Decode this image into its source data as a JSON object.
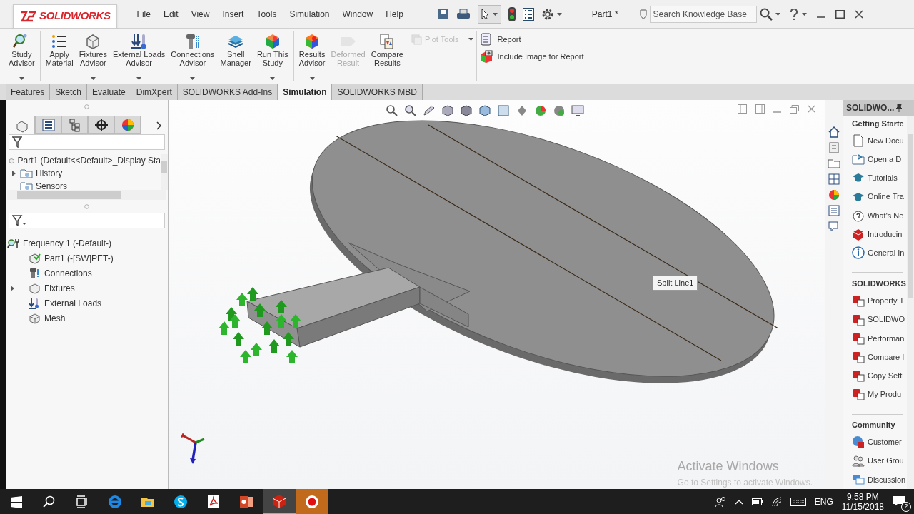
{
  "logo": {
    "brand": "SOLIDWORKS"
  },
  "menu": [
    {
      "label": "File"
    },
    {
      "label": "Edit"
    },
    {
      "label": "View"
    },
    {
      "label": "Insert"
    },
    {
      "label": "Tools"
    },
    {
      "label": "Simulation"
    },
    {
      "label": "Window"
    },
    {
      "label": "Help"
    }
  ],
  "document_title": "Part1 *",
  "search": {
    "placeholder": "Search Knowledge Base"
  },
  "ribbon": [
    {
      "label": "Study Advisor",
      "dropdown": true,
      "disabled": false
    },
    {
      "label": "Apply Material",
      "dropdown": false,
      "disabled": false
    },
    {
      "label": "Fixtures Advisor",
      "dropdown": true,
      "disabled": false
    },
    {
      "label": "External Loads Advisor",
      "dropdown": true,
      "disabled": false
    },
    {
      "label": "Connections Advisor",
      "dropdown": true,
      "disabled": false
    },
    {
      "label": "Shell Manager",
      "dropdown": false,
      "disabled": false
    },
    {
      "label": "Run This Study",
      "dropdown": true,
      "disabled": false
    },
    {
      "label": "Results Advisor",
      "dropdown": true,
      "disabled": false
    },
    {
      "label": "Deformed Result",
      "dropdown": false,
      "disabled": true
    },
    {
      "label": "Compare Results",
      "dropdown": false,
      "disabled": false
    }
  ],
  "plot_tools": {
    "label": "Plot Tools",
    "disabled": true
  },
  "report_tools": [
    {
      "label": "Report"
    },
    {
      "label": "Include Image for Report"
    }
  ],
  "command_tabs": [
    {
      "label": "Features",
      "selected": false
    },
    {
      "label": "Sketch",
      "selected": false
    },
    {
      "label": "Evaluate",
      "selected": false
    },
    {
      "label": "DimXpert",
      "selected": false
    },
    {
      "label": "SOLIDWORKS Add-Ins",
      "selected": false
    },
    {
      "label": "Simulation",
      "selected": true
    },
    {
      "label": "SOLIDWORKS MBD",
      "selected": false
    }
  ],
  "panel_tabs": [
    {
      "selected": true
    },
    {
      "selected": false
    },
    {
      "selected": false
    },
    {
      "selected": false
    },
    {
      "selected": false
    }
  ],
  "feature_manager": {
    "root": "Part1  (Default<<Default>_Display Sta",
    "items": [
      {
        "label": "History",
        "expandable": true
      },
      {
        "label": "Sensors",
        "expandable": false
      }
    ]
  },
  "simulation_tree": {
    "root": "Frequency 1 (-Default-)",
    "children": [
      {
        "label": "Part1 (-[SW]PET-)",
        "expandable": false
      },
      {
        "label": "Connections",
        "expandable": false
      },
      {
        "label": "Fixtures",
        "expandable": true
      },
      {
        "label": "External Loads",
        "expandable": false
      },
      {
        "label": "Mesh",
        "expandable": false
      }
    ]
  },
  "viewport": {
    "callout": "Split Line1"
  },
  "activation_notice": {
    "title": "Activate Windows",
    "subtitle": "Go to Settings to activate Windows."
  },
  "task_pane": {
    "title": "SOLIDWO...",
    "sections": [
      {
        "title": "Getting Starte",
        "items": [
          "New Docu",
          "Open a D",
          "Tutorials",
          "Online Tra",
          "What's Ne",
          "Introducin",
          "General In"
        ]
      },
      {
        "title": "SOLIDWORKS",
        "items": [
          "Property T",
          "SOLIDWO",
          "Performan",
          "Compare I",
          "Copy Setti",
          "My Produ"
        ]
      },
      {
        "title": "Community",
        "items": [
          "Customer",
          "User Grou",
          "Discussion"
        ]
      }
    ]
  },
  "taskbar": {
    "apps": [
      {
        "active": false,
        "highlighted": false
      },
      {
        "active": false,
        "highlighted": false
      },
      {
        "active": false,
        "highlighted": false
      },
      {
        "active": false,
        "highlighted": false
      },
      {
        "active": false,
        "highlighted": false
      },
      {
        "active": true,
        "highlighted": false
      },
      {
        "active": false,
        "highlighted": true
      }
    ]
  },
  "tray": {
    "language": "ENG",
    "time": "9:58 PM",
    "date": "11/15/2018",
    "notifications": "2"
  }
}
